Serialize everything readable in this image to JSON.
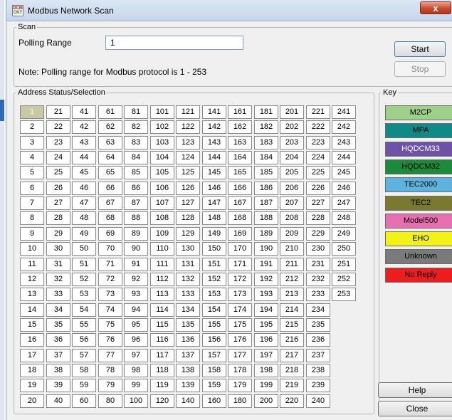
{
  "window": {
    "title": "Modbus Network Scan",
    "close_glyph": "x",
    "icon_text_top": "DCM",
    "icon_text_bottom": "CKT"
  },
  "scan": {
    "legend": "Scan",
    "polling_label": "Polling Range",
    "polling_value": "1",
    "note": "Note: Polling range for Modbus protocol is 1 - 253",
    "start_label": "Start",
    "stop_label": "Stop"
  },
  "address": {
    "legend": "Address Status/Selection",
    "selected": "1",
    "cells": [
      "1",
      "2",
      "3",
      "4",
      "5",
      "6",
      "7",
      "8",
      "9",
      "10",
      "11",
      "12",
      "13",
      "14",
      "15",
      "16",
      "17",
      "18",
      "19",
      "20",
      "21",
      "22",
      "23",
      "24",
      "25",
      "26",
      "27",
      "28",
      "29",
      "30",
      "31",
      "32",
      "33",
      "34",
      "35",
      "36",
      "37",
      "38",
      "39",
      "40",
      "41",
      "42",
      "43",
      "44",
      "45",
      "46",
      "47",
      "48",
      "49",
      "50",
      "51",
      "52",
      "53",
      "54",
      "55",
      "56",
      "57",
      "58",
      "59",
      "60",
      "61",
      "62",
      "63",
      "64",
      "65",
      "66",
      "67",
      "68",
      "69",
      "70",
      "71",
      "72",
      "73",
      "74",
      "75",
      "76",
      "77",
      "78",
      "79",
      "80",
      "81",
      "82",
      "83",
      "84",
      "85",
      "86",
      "87",
      "88",
      "89",
      "90",
      "91",
      "92",
      "93",
      "94",
      "95",
      "96",
      "97",
      "98",
      "99",
      "100",
      "101",
      "102",
      "103",
      "104",
      "105",
      "106",
      "107",
      "108",
      "109",
      "110",
      "111",
      "112",
      "113",
      "114",
      "115",
      "116",
      "117",
      "118",
      "119",
      "120",
      "121",
      "122",
      "123",
      "124",
      "125",
      "126",
      "127",
      "128",
      "129",
      "130",
      "131",
      "132",
      "133",
      "134",
      "135",
      "136",
      "137",
      "138",
      "139",
      "140",
      "141",
      "142",
      "143",
      "144",
      "145",
      "146",
      "147",
      "148",
      "149",
      "150",
      "151",
      "152",
      "153",
      "154",
      "155",
      "156",
      "157",
      "158",
      "159",
      "160",
      "161",
      "162",
      "163",
      "164",
      "165",
      "166",
      "167",
      "168",
      "169",
      "170",
      "171",
      "172",
      "173",
      "174",
      "175",
      "176",
      "177",
      "178",
      "179",
      "180",
      "181",
      "182",
      "183",
      "184",
      "185",
      "186",
      "187",
      "188",
      "189",
      "190",
      "191",
      "192",
      "193",
      "194",
      "195",
      "196",
      "197",
      "198",
      "199",
      "200",
      "201",
      "202",
      "203",
      "204",
      "205",
      "206",
      "207",
      "208",
      "209",
      "210",
      "211",
      "212",
      "213",
      "214",
      "215",
      "216",
      "217",
      "218",
      "219",
      "220",
      "221",
      "222",
      "223",
      "224",
      "225",
      "226",
      "227",
      "228",
      "229",
      "230",
      "231",
      "232",
      "233",
      "234",
      "235",
      "236",
      "237",
      "238",
      "239",
      "240",
      "241",
      "242",
      "243",
      "244",
      "245",
      "246",
      "247",
      "248",
      "249",
      "250",
      "251",
      "252",
      "253"
    ]
  },
  "key": {
    "legend": "Key",
    "items": [
      {
        "label": "M2CP",
        "bg": "#9ed08a",
        "fg": "#000000"
      },
      {
        "label": "MPA",
        "bg": "#0f8a86",
        "fg": "#000000"
      },
      {
        "label": "HQDCM33",
        "bg": "#6e52a8",
        "fg": "#ffffff"
      },
      {
        "label": "HQDCM32",
        "bg": "#1b8a3a",
        "fg": "#000000"
      },
      {
        "label": "TEC2000",
        "bg": "#5bb3e0",
        "fg": "#000000"
      },
      {
        "label": "TEC2",
        "bg": "#7a7a2e",
        "fg": "#000000"
      },
      {
        "label": "Model500",
        "bg": "#e86fb2",
        "fg": "#000000"
      },
      {
        "label": "EHO",
        "bg": "#f2f214",
        "fg": "#000000"
      },
      {
        "label": "Unknown",
        "bg": "#7a7a7a",
        "fg": "#000000"
      },
      {
        "label": "No Reply",
        "bg": "#ee1c1c",
        "fg": "#000000"
      }
    ]
  },
  "buttons": {
    "help_label": "Help",
    "close_label": "Close"
  }
}
